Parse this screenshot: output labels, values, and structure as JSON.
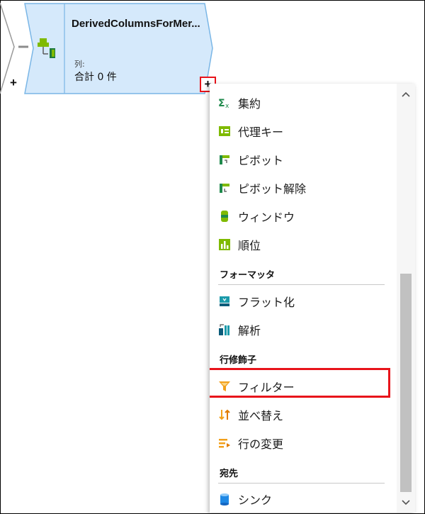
{
  "node": {
    "title": "DerivedColumnsForMer...",
    "columns_label": "列:",
    "columns_value": "合計 0 件",
    "add_left": "+",
    "add_right": "+"
  },
  "menu": {
    "items_top": [
      {
        "label": "集約",
        "icon": "aggregate-icon"
      },
      {
        "label": "代理キー",
        "icon": "surrogate-key-icon"
      },
      {
        "label": "ピボット",
        "icon": "pivot-icon"
      },
      {
        "label": "ピボット解除",
        "icon": "unpivot-icon"
      },
      {
        "label": "ウィンドウ",
        "icon": "window-icon"
      },
      {
        "label": "順位",
        "icon": "rank-icon"
      }
    ],
    "formatters": {
      "title": "フォーマッタ",
      "items": [
        {
          "label": "フラット化",
          "icon": "flatten-icon"
        },
        {
          "label": "解析",
          "icon": "parse-icon"
        }
      ]
    },
    "row_modifiers": {
      "title": "行修飾子",
      "items": [
        {
          "label": "フィルター",
          "icon": "filter-icon"
        },
        {
          "label": "並べ替え",
          "icon": "sort-icon"
        },
        {
          "label": "行の変更",
          "icon": "alter-row-icon"
        }
      ]
    },
    "destination": {
      "title": "宛先",
      "items": [
        {
          "label": "シンク",
          "icon": "sink-icon"
        }
      ]
    },
    "scroll_up": "^",
    "scroll_down": "v"
  },
  "colors": {
    "node_fill": "#d5e9fb",
    "node_border": "#7ab6e6",
    "highlight": "#e8141b"
  }
}
